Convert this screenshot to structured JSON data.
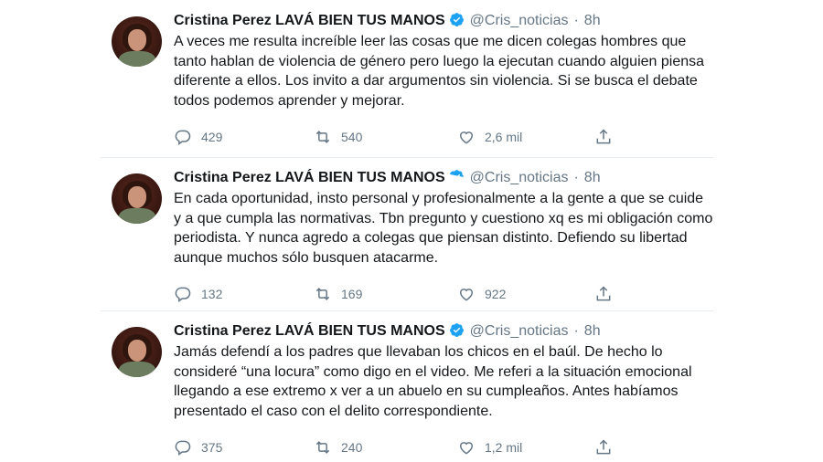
{
  "author": {
    "name": "Cristina Perez LAVÁ BIEN TUS MANOS",
    "handle": "@Cris_noticias",
    "separator": "·",
    "time": "8h"
  },
  "tweets": [
    {
      "text": "A veces me resulta increíble leer las cosas que me dicen colegas hombres que tanto hablan de violencia de género pero luego la ejecutan cuando alguien piensa diferente a ellos. Los invito a dar argumentos sin violencia. Si se busca el debate todos podemos aprender y mejorar.",
      "replies": "429",
      "retweets": "540",
      "likes": "2,6 mil"
    },
    {
      "text": "En cada oportunidad, insto personal y profesionalmente a la gente a que se cuide y a que cumpla las normativas. Tbn pregunto y cuestiono xq es mi obligación como periodista. Y nunca agredo a colegas que piensan distinto. Defiendo su libertad aunque muchos sólo busquen atacarme.",
      "replies": "132",
      "retweets": "169",
      "likes": "922"
    },
    {
      "text": "Jamás defendí a los padres que llevaban los chicos en el baúl. De hecho lo consideré “una locura” como digo en el video. Me referi a la situación emocional llegando a ese extremo x ver a un abuelo en su cumpleaños. Antes habíamos presentado el caso con el delito correspondiente.",
      "replies": "375",
      "retweets": "240",
      "likes": "1,2 mil"
    }
  ],
  "colors": {
    "verified": "#1da1f2",
    "muted": "#657786",
    "text": "#14171a"
  },
  "icons": [
    "reply-icon",
    "retweet-icon",
    "like-icon",
    "share-icon",
    "verified-badge-icon"
  ]
}
